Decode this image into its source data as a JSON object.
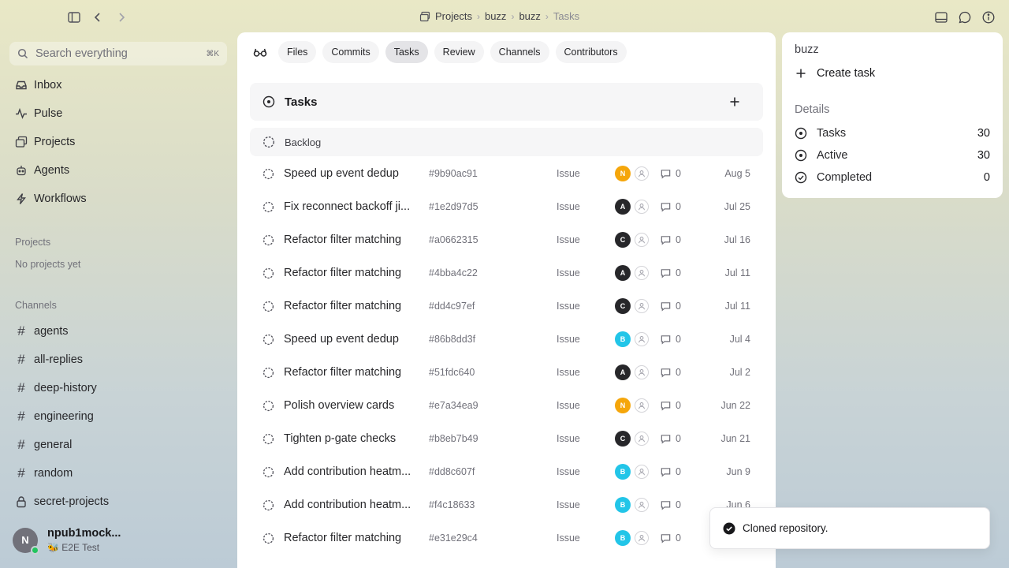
{
  "breadcrumb": [
    "Projects",
    "buzz",
    "buzz",
    "Tasks"
  ],
  "sidebar": {
    "search_placeholder": "Search everything",
    "search_shortcut": "⌘K",
    "nav": [
      {
        "label": "Inbox",
        "icon": "inbox-icon"
      },
      {
        "label": "Pulse",
        "icon": "pulse-icon"
      },
      {
        "label": "Projects",
        "icon": "projects-icon"
      },
      {
        "label": "Agents",
        "icon": "agents-icon"
      },
      {
        "label": "Workflows",
        "icon": "workflows-icon"
      }
    ],
    "projects_label": "Projects",
    "projects_empty": "No projects yet",
    "channels_label": "Channels",
    "channels": [
      {
        "label": "agents",
        "icon": "hash-icon"
      },
      {
        "label": "all-replies",
        "icon": "hash-icon"
      },
      {
        "label": "deep-history",
        "icon": "hash-icon"
      },
      {
        "label": "engineering",
        "icon": "hash-icon"
      },
      {
        "label": "general",
        "icon": "hash-icon"
      },
      {
        "label": "random",
        "icon": "hash-icon"
      },
      {
        "label": "secret-projects",
        "icon": "lock-icon"
      }
    ],
    "user": {
      "initial": "N",
      "name": "npub1mock...",
      "status": "🐝 E2E Test"
    }
  },
  "main": {
    "tabs": [
      "Files",
      "Commits",
      "Tasks",
      "Review",
      "Channels",
      "Contributors"
    ],
    "active_tab": "Tasks",
    "tasks_title": "Tasks",
    "group_label": "Backlog",
    "rows": [
      {
        "title": "Speed up event dedup",
        "hash": "#9b90ac91",
        "kind": "Issue",
        "avatar": "N",
        "avatar_color": "#f5a60b",
        "comments": "0",
        "date": "Aug 5"
      },
      {
        "title": "Fix reconnect backoff ji...",
        "hash": "#1e2d97d5",
        "kind": "Issue",
        "avatar": "A",
        "avatar_color": "#27272a",
        "comments": "0",
        "date": "Jul 25"
      },
      {
        "title": "Refactor filter matching",
        "hash": "#a0662315",
        "kind": "Issue",
        "avatar": "C",
        "avatar_color": "#27272a",
        "comments": "0",
        "date": "Jul 16"
      },
      {
        "title": "Refactor filter matching",
        "hash": "#4bba4c22",
        "kind": "Issue",
        "avatar": "A",
        "avatar_color": "#27272a",
        "comments": "0",
        "date": "Jul 11"
      },
      {
        "title": "Refactor filter matching",
        "hash": "#dd4c97ef",
        "kind": "Issue",
        "avatar": "C",
        "avatar_color": "#27272a",
        "comments": "0",
        "date": "Jul 11"
      },
      {
        "title": "Speed up event dedup",
        "hash": "#86b8dd3f",
        "kind": "Issue",
        "avatar": "B",
        "avatar_color": "#22c5e8",
        "comments": "0",
        "date": "Jul 4"
      },
      {
        "title": "Refactor filter matching",
        "hash": "#51fdc640",
        "kind": "Issue",
        "avatar": "A",
        "avatar_color": "#27272a",
        "comments": "0",
        "date": "Jul 2"
      },
      {
        "title": "Polish overview cards",
        "hash": "#e7a34ea9",
        "kind": "Issue",
        "avatar": "N",
        "avatar_color": "#f5a60b",
        "comments": "0",
        "date": "Jun 22"
      },
      {
        "title": "Tighten p-gate checks",
        "hash": "#b8eb7b49",
        "kind": "Issue",
        "avatar": "C",
        "avatar_color": "#27272a",
        "comments": "0",
        "date": "Jun 21"
      },
      {
        "title": "Add contribution heatm...",
        "hash": "#dd8c607f",
        "kind": "Issue",
        "avatar": "B",
        "avatar_color": "#22c5e8",
        "comments": "0",
        "date": "Jun 9"
      },
      {
        "title": "Add contribution heatm...",
        "hash": "#f4c18633",
        "kind": "Issue",
        "avatar": "B",
        "avatar_color": "#22c5e8",
        "comments": "0",
        "date": "Jun 6"
      },
      {
        "title": "Refactor filter matching",
        "hash": "#e31e29c4",
        "kind": "Issue",
        "avatar": "B",
        "avatar_color": "#22c5e8",
        "comments": "0",
        "date": ""
      }
    ]
  },
  "right_panel": {
    "title": "buzz",
    "create_label": "Create task",
    "details_label": "Details",
    "stats": [
      {
        "label": "Tasks",
        "value": "30",
        "icon": "circle-dot-icon"
      },
      {
        "label": "Active",
        "value": "30",
        "icon": "circle-dot-icon"
      },
      {
        "label": "Completed",
        "value": "0",
        "icon": "check-circle-icon"
      }
    ]
  },
  "toast": {
    "message": "Cloned repository."
  }
}
